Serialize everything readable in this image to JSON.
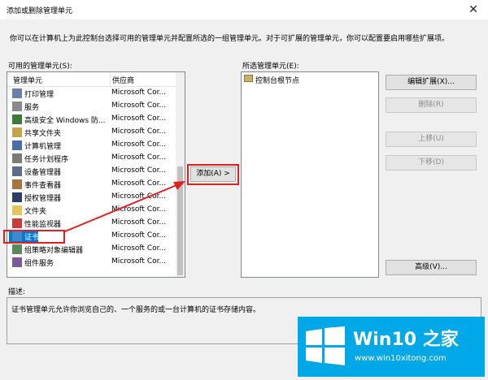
{
  "window": {
    "title": "添加或删除管理单元",
    "close_label": "✕",
    "description": "你可以在计算机上为此控制台选择可用的管理单元并配置所选的一组管理单元。对于可扩展的管理单元，你可以配置要启用哪些扩展项。"
  },
  "available": {
    "label": "可用的管理单元(S):",
    "col_name": "管理单元",
    "col_vendor": "供应商",
    "items": [
      {
        "name": "打印管理",
        "vendor": "Microsoft Cor...",
        "icon": "printer-icon"
      },
      {
        "name": "服务",
        "vendor": "Microsoft Cor...",
        "icon": "gear-icon"
      },
      {
        "name": "高级安全 Windows 防...",
        "vendor": "Microsoft Cor...",
        "icon": "shield-icon"
      },
      {
        "name": "共享文件夹",
        "vendor": "Microsoft Cor...",
        "icon": "shared-folder-icon"
      },
      {
        "name": "计算机管理",
        "vendor": "Microsoft Cor...",
        "icon": "computer-icon"
      },
      {
        "name": "任务计划程序",
        "vendor": "Microsoft Cor...",
        "icon": "clock-icon"
      },
      {
        "name": "设备管理器",
        "vendor": "Microsoft Cor...",
        "icon": "device-icon"
      },
      {
        "name": "事件查看器",
        "vendor": "Microsoft Cor...",
        "icon": "event-icon"
      },
      {
        "name": "授权管理器",
        "vendor": "Microsoft Cor...",
        "icon": "authorization-icon"
      },
      {
        "name": "文件夹",
        "vendor": "Microsoft Cor...",
        "icon": "folder-icon"
      },
      {
        "name": "性能监视器",
        "vendor": "Microsoft Cor...",
        "icon": "performance-icon"
      },
      {
        "name": "证书",
        "vendor": "Microsoft Cor...",
        "icon": "certificate-icon"
      },
      {
        "name": "组策略对象编辑器",
        "vendor": "Microsoft Cor...",
        "icon": "policy-icon"
      },
      {
        "name": "组件服务",
        "vendor": "Microsoft Cor...",
        "icon": "component-icon"
      }
    ],
    "selected_index": 11
  },
  "add_button": "添加(A) >",
  "selected": {
    "label": "所选管理单元(E):",
    "root_node": "控制台根节点"
  },
  "buttons": {
    "edit_extensions": "编辑扩展(X)...",
    "remove": "删除(R)",
    "move_up": "上移(U)",
    "move_down": "下移(D)",
    "advanced": "高级(V)..."
  },
  "description": {
    "label": "描述:",
    "text": "证书管理单元允许你浏览自己的、一个服务的或一台计算机的证书存储内容。"
  },
  "watermark": {
    "brand": "Win10 之家",
    "url": "www.win10xitong.com"
  },
  "colors": {
    "selection": "#0078d7",
    "highlight": "#e02020",
    "logo_bg": "#00a8e8"
  }
}
